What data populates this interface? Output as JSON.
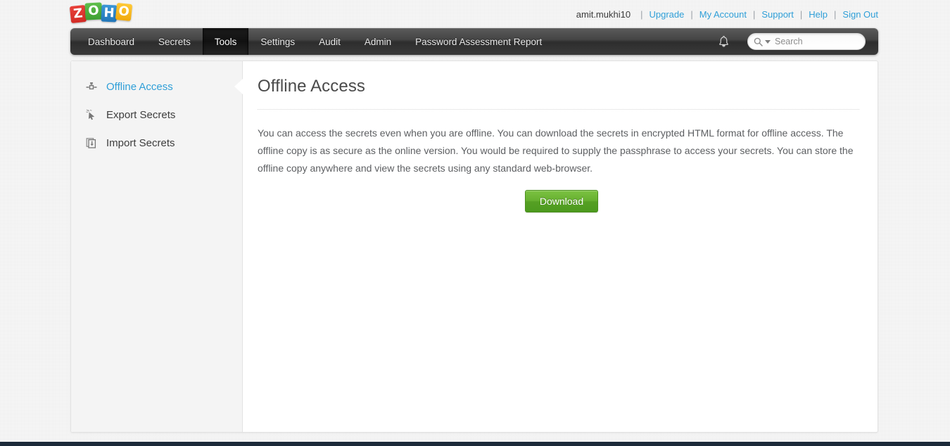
{
  "header": {
    "logo": {
      "name": "zoho-logo",
      "letters": [
        "Z",
        "O",
        "H",
        "O"
      ],
      "colors": [
        "#d93025",
        "#46a83c",
        "#2d82c6",
        "#f5b418"
      ]
    },
    "account": {
      "username": "amit.mukhi10",
      "separator": "|",
      "links": [
        {
          "label": "Upgrade"
        },
        {
          "label": "My Account"
        },
        {
          "label": "Support"
        },
        {
          "label": "Help"
        },
        {
          "label": "Sign Out"
        }
      ]
    }
  },
  "nav": {
    "items": [
      {
        "label": "Dashboard",
        "active": false
      },
      {
        "label": "Secrets",
        "active": false
      },
      {
        "label": "Tools",
        "active": true
      },
      {
        "label": "Settings",
        "active": false
      },
      {
        "label": "Audit",
        "active": false
      },
      {
        "label": "Admin",
        "active": false
      },
      {
        "label": "Password Assessment Report",
        "active": false
      }
    ],
    "notifications_icon": "bell-icon",
    "search": {
      "placeholder": "Search",
      "value": "",
      "icon": "search-icon",
      "caret": "chevron-down-icon"
    }
  },
  "sidebar": {
    "items": [
      {
        "label": "Offline Access",
        "icon": "offline-access-icon",
        "active": true
      },
      {
        "label": "Export Secrets",
        "icon": "export-cursor-icon",
        "active": false
      },
      {
        "label": "Import Secrets",
        "icon": "import-document-icon",
        "active": false
      }
    ]
  },
  "main": {
    "title": "Offline Access",
    "description": "You can access the secrets even when you are offline. You can download the secrets in encrypted HTML format for offline access. The offline copy is as secure as the online version. You would be required to supply the passphrase to access your secrets. You can store the offline copy anywhere and view the secrets using any standard web-browser.",
    "download_button": "Download"
  },
  "theme": {
    "link_color": "#2f9fd8",
    "accent_green": "#62ae2d",
    "nav_bg": "#3d3d3d",
    "footer_bg": "#1c2a3a"
  }
}
